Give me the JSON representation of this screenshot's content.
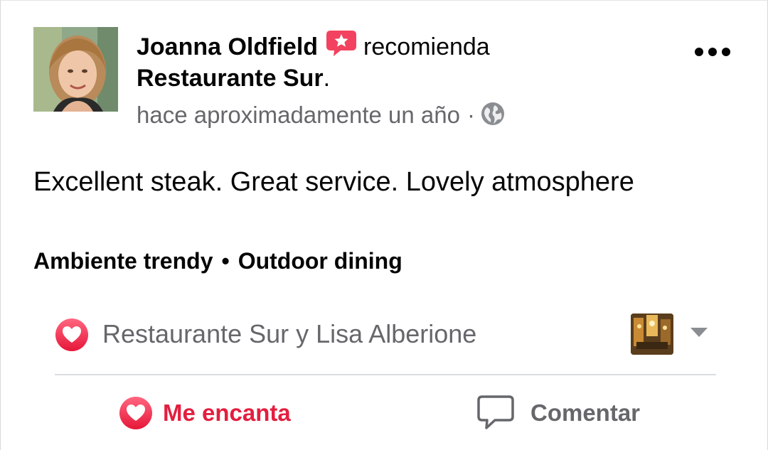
{
  "post": {
    "author": "Joanna Oldfield",
    "verb": "recomienda",
    "place": "Restaurante Sur",
    "place_suffix": ".",
    "timestamp": "hace aproximadamente un año",
    "meta_separator": "·",
    "audience_icon": "globe-icon",
    "recommend_icon": "recommendation-star-icon",
    "more_icon": "more-options-icon",
    "body": "Excellent steak. Great service. Lovely atmosphere",
    "tags": [
      "Ambiente trendy",
      "Outdoor dining"
    ],
    "tag_separator": "•"
  },
  "reactions": {
    "icon": "love-reaction-icon",
    "names": "Restaurante Sur y Lisa Alberione",
    "expand_icon": "caret-down-icon"
  },
  "actions": {
    "love_label": "Me encanta",
    "love_icon": "love-icon",
    "comment_label": "Comentar",
    "comment_icon": "comment-icon"
  },
  "colors": {
    "love_red": "#e41e3f",
    "recommend_pink": "#f3425f",
    "secondary_text": "#65676b",
    "primary_text": "#050505",
    "divider": "#dadde1"
  }
}
